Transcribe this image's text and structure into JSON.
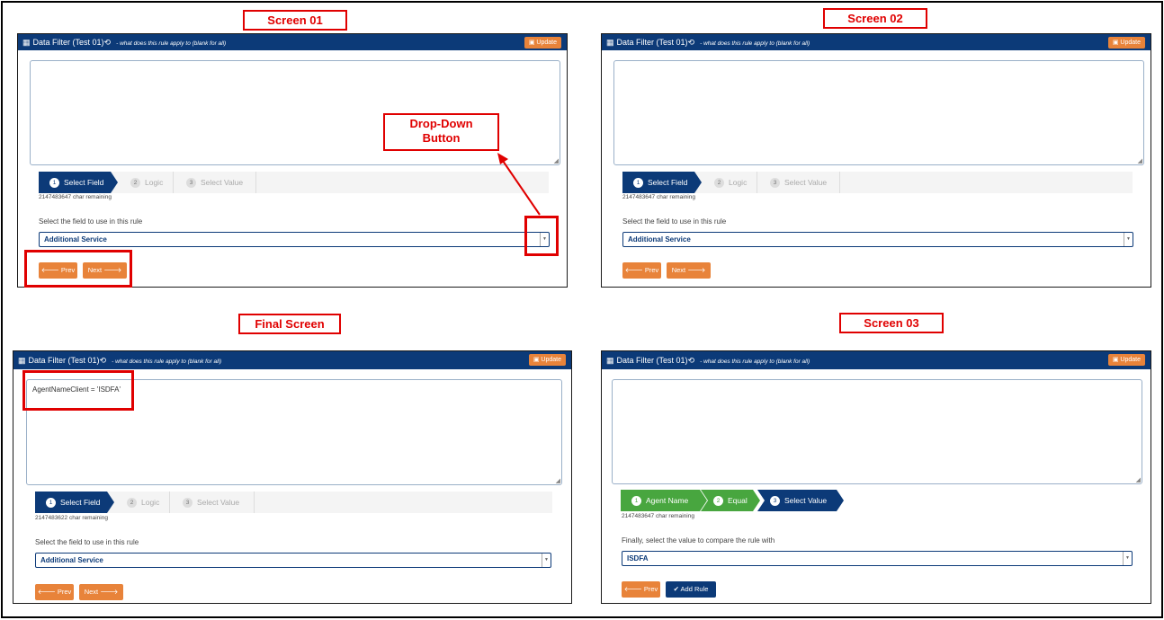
{
  "labels": {
    "screen01": "Screen 01",
    "screen02": "Screen 02",
    "final": "Final Screen",
    "screen03": "Screen 03",
    "dropdown_callout_line1": "Drop-Down",
    "dropdown_callout_line2": "Button"
  },
  "panel": {
    "header_icon": "table-icon",
    "title": "Data Filter (Test 01)",
    "history_icon": "⟲",
    "subtitle": "- what does this rule apply to (blank for all)",
    "update_label": "Update",
    "update_icon": "save-icon"
  },
  "steps": {
    "s1_num": "1",
    "s1_label": "Select Field",
    "s2_num": "2",
    "s2_label": "Logic",
    "s3_num": "3",
    "s3_label": "Select Value"
  },
  "screen01": {
    "textarea": "",
    "remaining": "2147483647 char remaining",
    "field_label": "Select the field to use in this rule",
    "select_value": "Additional Service",
    "prev_label": "Prev",
    "next_label": "Next"
  },
  "screen02": {
    "textarea": "",
    "remaining": "2147483647 char remaining",
    "field_label": "Select the field to use in this rule",
    "select_value": "Additional Service",
    "prev_label": "Prev",
    "next_label": "Next"
  },
  "final": {
    "textarea": "AgentNameClient = 'ISDFA'",
    "remaining": "2147483622 char remaining",
    "field_label": "Select the field to use in this rule",
    "select_value": "Additional Service",
    "prev_label": "Prev",
    "next_label": "Next"
  },
  "screen03": {
    "textarea": "",
    "step1_label": "Agent Name",
    "step2_label": "Equal",
    "step3_label": "Select Value",
    "remaining": "2147483647 char remaining",
    "field_label": "Finally, select the value to compare the rule with",
    "select_value": "ISDFA",
    "prev_label": "Prev",
    "add_rule_label": "Add Rule"
  },
  "colors": {
    "header": "#0c3a78",
    "accent_orange": "#e8833a",
    "step_done": "#48a63f",
    "annotation_red": "#e00000"
  }
}
